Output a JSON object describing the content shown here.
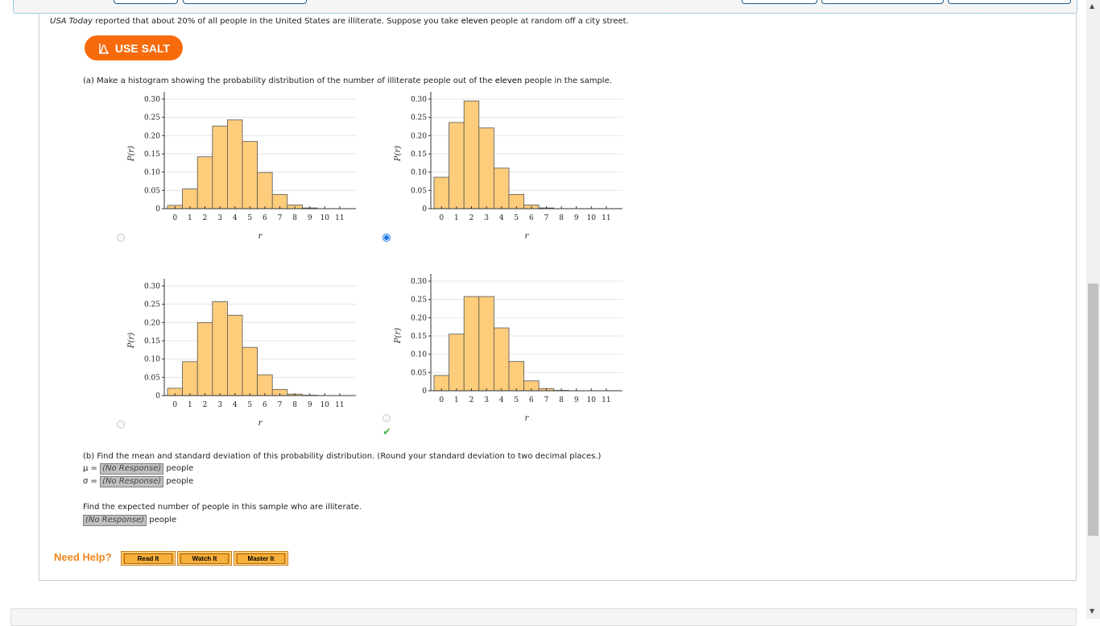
{
  "question": {
    "intro_source": "USA Today",
    "intro_rest_1": " reported that about 20% of all people in the United States are illiterate. Suppose you take ",
    "intro_bold": "eleven",
    "intro_rest_2": " people at random off a city street.",
    "salt_button": "USE SALT",
    "part_a_1": "(a) Make a histogram showing the probability distribution of the number of illiterate people out of the ",
    "part_a_bold": "eleven",
    "part_a_2": " people in the sample.",
    "part_b": "(b) Find the mean and standard deviation of this probability distribution. (Round your standard deviation to two decimal places.)",
    "mu_label": "μ =",
    "sigma_label": "σ =",
    "no_response": "(No Response)",
    "unit": "people",
    "expected_prompt": "Find the expected number of people in this sample who are illiterate."
  },
  "options": [
    {
      "id": "A",
      "selected": false
    },
    {
      "id": "B",
      "selected": true
    },
    {
      "id": "C",
      "selected": false
    },
    {
      "id": "D",
      "selected": false,
      "correct_mark": "✔"
    }
  ],
  "help": {
    "label": "Need Help?",
    "buttons": [
      "Read It",
      "Watch It",
      "Master It"
    ]
  },
  "chart_data": [
    {
      "type": "bar",
      "title": "",
      "xlabel": "r",
      "ylabel": "P(r)",
      "categories": [
        "0",
        "1",
        "2",
        "3",
        "4",
        "5",
        "6",
        "7",
        "8",
        "9",
        "10",
        "11"
      ],
      "values": [
        0.009,
        0.054,
        0.142,
        0.226,
        0.243,
        0.184,
        0.099,
        0.039,
        0.01,
        0.002,
        0.0,
        0.0
      ],
      "yticks": [
        "0",
        "0.05",
        "0.10",
        "0.15",
        "0.20",
        "0.25",
        "0.30"
      ],
      "ylim": [
        0,
        0.3
      ],
      "grid": true
    },
    {
      "type": "bar",
      "title": "",
      "xlabel": "r",
      "ylabel": "P(r)",
      "categories": [
        "0",
        "1",
        "2",
        "3",
        "4",
        "5",
        "6",
        "7",
        "8",
        "9",
        "10",
        "11"
      ],
      "values": [
        0.086,
        0.236,
        0.295,
        0.221,
        0.111,
        0.039,
        0.01,
        0.002,
        0.0,
        0.0,
        0.0,
        0.0
      ],
      "yticks": [
        "0",
        "0.05",
        "0.10",
        "0.15",
        "0.20",
        "0.25",
        "0.30"
      ],
      "ylim": [
        0,
        0.3
      ],
      "grid": true
    },
    {
      "type": "bar",
      "title": "",
      "xlabel": "r",
      "ylabel": "P(r)",
      "categories": [
        "0",
        "1",
        "2",
        "3",
        "4",
        "5",
        "6",
        "7",
        "8",
        "9",
        "10",
        "11"
      ],
      "values": [
        0.02,
        0.093,
        0.2,
        0.257,
        0.22,
        0.132,
        0.057,
        0.017,
        0.004,
        0.001,
        0.0,
        0.0
      ],
      "yticks": [
        "0",
        "0.05",
        "0.10",
        "0.15",
        "0.20",
        "0.25",
        "0.30"
      ],
      "ylim": [
        0,
        0.3
      ],
      "grid": true
    },
    {
      "type": "bar",
      "title": "",
      "xlabel": "r",
      "ylabel": "P(r)",
      "categories": [
        "0",
        "1",
        "2",
        "3",
        "4",
        "5",
        "6",
        "7",
        "8",
        "9",
        "10",
        "11"
      ],
      "values": [
        0.042,
        0.155,
        0.258,
        0.258,
        0.172,
        0.08,
        0.027,
        0.006,
        0.001,
        0.0,
        0.0,
        0.0
      ],
      "yticks": [
        "0",
        "0.05",
        "0.10",
        "0.15",
        "0.20",
        "0.25",
        "0.30"
      ],
      "ylim": [
        0,
        0.3
      ],
      "grid": true
    }
  ]
}
